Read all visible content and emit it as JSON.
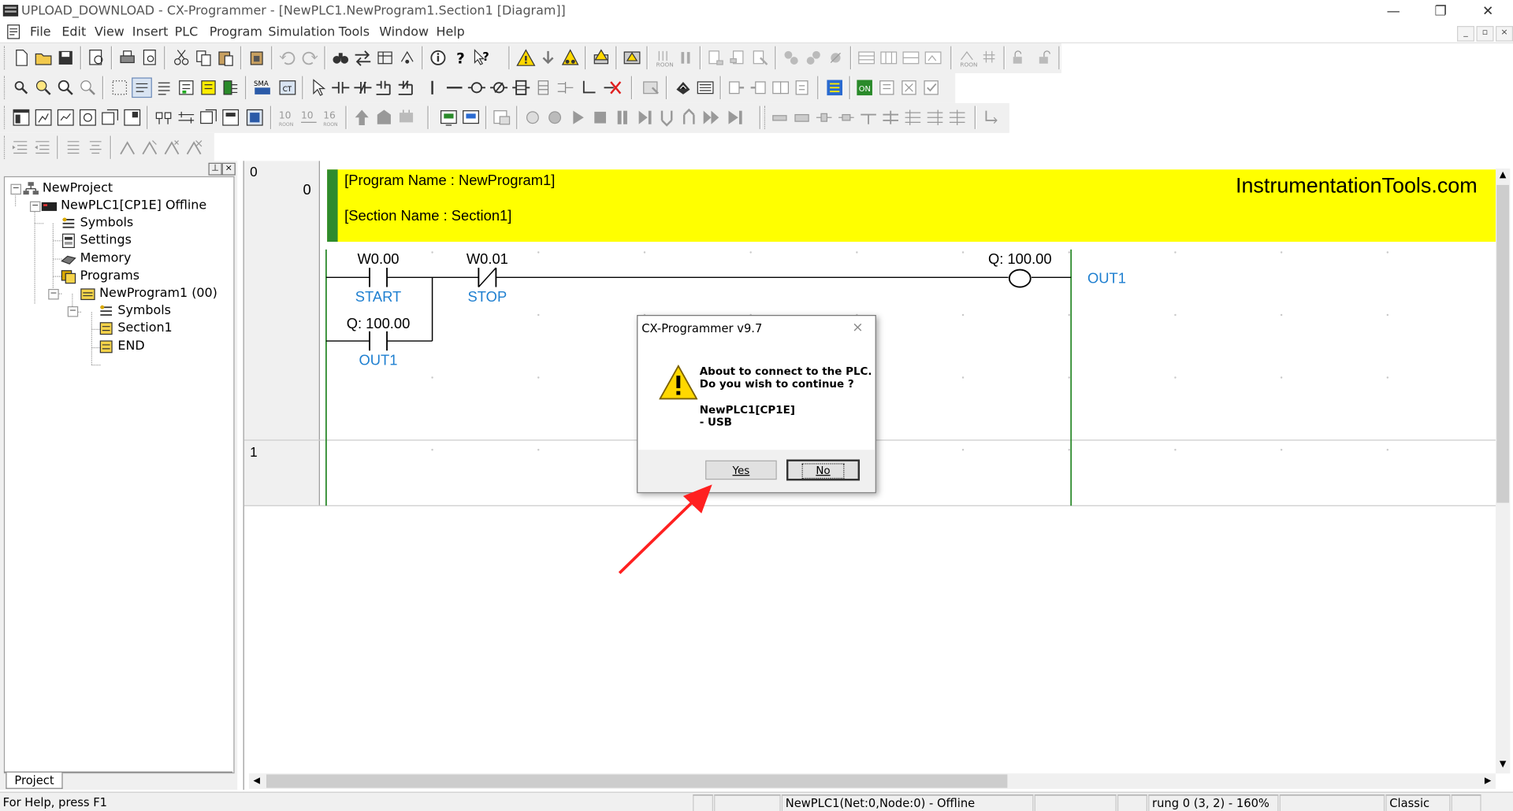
{
  "window": {
    "title": "UPLOAD_DOWNLOAD - CX-Programmer - [NewPLC1.NewProgram1.Section1 [Diagram]]",
    "controls": {
      "minimize": "—",
      "restore": "❐",
      "close": "✕"
    }
  },
  "menu": {
    "items": [
      "File",
      "Edit",
      "View",
      "Insert",
      "PLC",
      "Program",
      "Simulation",
      "Tools",
      "Window",
      "Help"
    ],
    "mdi_controls": {
      "minimize": "_",
      "restore": "▫",
      "close": "×"
    }
  },
  "project_tree": {
    "panel_controls": {
      "pin": "⊥",
      "close": "×"
    },
    "items": [
      {
        "label": "NewProject",
        "icon": "project-icon"
      },
      {
        "label": "NewPLC1[CP1E] Offline",
        "icon": "plc-icon"
      },
      {
        "label": "Symbols",
        "icon": "symbols-icon"
      },
      {
        "label": "Settings",
        "icon": "settings-icon"
      },
      {
        "label": "Memory",
        "icon": "memory-icon"
      },
      {
        "label": "Programs",
        "icon": "programs-icon"
      },
      {
        "label": "NewProgram1 (00)",
        "icon": "program-icon"
      },
      {
        "label": "Symbols",
        "icon": "symbols-icon"
      },
      {
        "label": "Section1",
        "icon": "section-icon"
      },
      {
        "label": "END",
        "icon": "section-icon"
      }
    ],
    "tab": "Project"
  },
  "diagram": {
    "header": {
      "program_name": "[Program Name : NewProgram1]",
      "section_name": "[Section Name : Section1]",
      "watermark": "InstrumentationTools.com",
      "color": "#ffff00"
    },
    "rungs": [
      {
        "number": "0",
        "step": "0"
      },
      {
        "number": "1",
        "step": ""
      }
    ],
    "contacts": [
      {
        "address": "W0.00",
        "comment": "START",
        "type": "normally-open"
      },
      {
        "address": "W0.01",
        "comment": "STOP",
        "type": "normally-closed"
      },
      {
        "address": "Q: 100.00",
        "comment": "OUT1",
        "type": "normally-open"
      }
    ],
    "coil": {
      "address": "Q: 100.00",
      "comment": "OUT1"
    },
    "rail_color": "#2e8b2e",
    "comment_color": "#1e7fd0"
  },
  "dialog": {
    "title": "CX-Programmer v9.7",
    "close": "×",
    "line1": "About to connect to the PLC.",
    "line2": "Do you wish to continue ?",
    "device": "NewPLC1[CP1E]",
    "connection": "- USB",
    "yes": "Yes",
    "no": "No"
  },
  "annotation": {
    "arrow_color": "#ff2020"
  },
  "status_bar": {
    "help": "For Help, press F1",
    "plc": "NewPLC1(Net:0,Node:0) - Offline",
    "position": "rung 0 (3, 2)  - 160%",
    "mode": "Classic"
  }
}
